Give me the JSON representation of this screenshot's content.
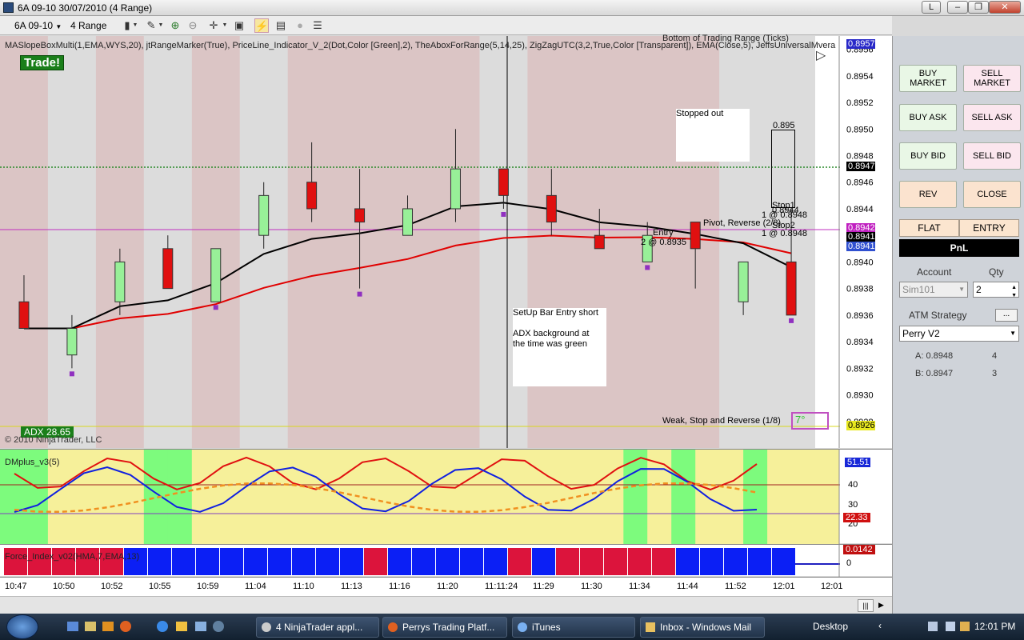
{
  "window": {
    "title": "6A 09-10  30/07/2010 (4 Range)",
    "btn_l": "L",
    "btn_min": "‒",
    "btn_max": "❐",
    "btn_close": "✕"
  },
  "toolbar": {
    "instrument": "6A 09-10",
    "period": "4 Range"
  },
  "chart": {
    "indicators_line": "MASlopeBoxMulti(1,EMA,WYS,20), jtRangeMarker(True), PriceLine_Indicator_V_2(Dot,Color [Green],2), TheAboxForRange(5,14,25), ZigZagUTC(3,2,True,Color [Transparent]), EMA(Close,5), JeffsUniversalM",
    "indicators_tail": "vera",
    "hidden_label": "Bottom of Trading Range (Ticks)",
    "trade_badge": "Trade!",
    "adx_badge": "ADX 28.65",
    "copyright": "© 2010 NinjaTrader, LLC",
    "y_labels": [
      "0.8956",
      "0.8954",
      "0.8952",
      "0.8950",
      "0.8948",
      "0.8946",
      "0.8944",
      "0.8942",
      "0.8940",
      "0.8938",
      "0.8936",
      "0.8934",
      "0.8932",
      "0.8930",
      "0.8928"
    ],
    "tags": {
      "top": "0.8957",
      "price": "0.8947",
      "pink": "0.8942",
      "black": "0.8941",
      "blue": "0.8941",
      "bottom": "0.8926"
    },
    "annotations": {
      "stopped_out": "Stopped out",
      "setup_line1": "SetUp Bar Entry short",
      "setup_line2": "ADX background at",
      "setup_line3": "the time was green",
      "entry_line1": "Entry",
      "entry_line2": "2 @ 0.8935",
      "pivot": "Pivot, Reverse (2/8)",
      "stop1": "Stop1",
      "stop1_val": "1 @ 0.8948",
      "stop2": "Stop2",
      "stop2_val": "1 @ 0.8948",
      "target_895": "0.895",
      "target_8944": "0.8944",
      "weak": "Weak, Stop and Reverse (1/8)",
      "degrees": "7°"
    }
  },
  "dm_panel": {
    "title": "DMplus_v3(5)",
    "y_labels": [
      "40",
      "30",
      "20"
    ],
    "tag_blue": "51.51",
    "tag_red": "22.33"
  },
  "force_panel": {
    "title": "Force_Index_v02(HMA,7,EMA,13)",
    "tag": "0.0142",
    "zero": "0"
  },
  "x_axis": [
    "10:47",
    "10:50",
    "10:52",
    "10:55",
    "10:59",
    "11:04",
    "11:10",
    "11:13",
    "11:16",
    "11:20",
    "11:11:24",
    "11:29",
    "11:30",
    "11:34",
    "11:44",
    "11:52",
    "12:01",
    "12:01"
  ],
  "side": {
    "buy_market": "BUY MARKET",
    "sell_market": "SELL MARKET",
    "buy_ask": "BUY ASK",
    "sell_ask": "SELL ASK",
    "buy_bid": "BUY BID",
    "sell_bid": "SELL BID",
    "rev": "REV",
    "close": "CLOSE",
    "flat": "FLAT",
    "entry": "ENTRY",
    "pnl": "PnL",
    "account_label": "Account",
    "qty_label": "Qty",
    "account_value": "Sim101",
    "qty_value": "2",
    "atm_label": "ATM Strategy",
    "atm_btn": "...",
    "atm_value": "Perry V2",
    "a_label": "A: 0.8948",
    "a_count": "4",
    "b_label": "B: 0.8947",
    "b_count": "3"
  },
  "taskbar": {
    "items": [
      "4 NinjaTrader appl...",
      "Perrys Trading Platf...",
      "iTunes",
      "Inbox - Windows Mail"
    ],
    "desktop": "Desktop",
    "clock": "12:01 PM"
  },
  "chart_data": [
    {
      "type": "candlestick",
      "title": "6A 09-10  30/07/2010 (4 Range)",
      "x": [
        "10:47",
        "10:50",
        "10:52",
        "10:55",
        "10:59",
        "11:04",
        "11:10",
        "11:13",
        "11:16",
        "11:20",
        "11:11:24",
        "11:29",
        "11:30",
        "11:34",
        "11:44",
        "11:52",
        "12:01"
      ],
      "candles": [
        {
          "o": 0.8937,
          "c": 0.8935,
          "h": 0.8939,
          "l": 0.8935,
          "dir": "down"
        },
        {
          "o": 0.8933,
          "c": 0.8935,
          "h": 0.8936,
          "l": 0.8932,
          "dir": "up"
        },
        {
          "o": 0.8937,
          "c": 0.894,
          "h": 0.8941,
          "l": 0.8936,
          "dir": "up"
        },
        {
          "o": 0.8941,
          "c": 0.8938,
          "h": 0.8942,
          "l": 0.8938,
          "dir": "down"
        },
        {
          "o": 0.8937,
          "c": 0.8941,
          "h": 0.8941,
          "l": 0.8937,
          "dir": "up"
        },
        {
          "o": 0.8942,
          "c": 0.8945,
          "h": 0.8946,
          "l": 0.8941,
          "dir": "up"
        },
        {
          "o": 0.8946,
          "c": 0.8944,
          "h": 0.8949,
          "l": 0.8943,
          "dir": "down"
        },
        {
          "o": 0.8944,
          "c": 0.8943,
          "h": 0.8947,
          "l": 0.8938,
          "dir": "down"
        },
        {
          "o": 0.8942,
          "c": 0.8944,
          "h": 0.8945,
          "l": 0.8942,
          "dir": "up"
        },
        {
          "o": 0.8944,
          "c": 0.8947,
          "h": 0.895,
          "l": 0.8943,
          "dir": "up"
        },
        {
          "o": 0.8947,
          "c": 0.8945,
          "h": 0.8947,
          "l": 0.8944,
          "dir": "down"
        },
        {
          "o": 0.8945,
          "c": 0.8943,
          "h": 0.8947,
          "l": 0.8942,
          "dir": "down"
        },
        {
          "o": 0.8942,
          "c": 0.8941,
          "h": 0.8944,
          "l": 0.8941,
          "dir": "down"
        },
        {
          "o": 0.894,
          "c": 0.8942,
          "h": 0.8943,
          "l": 0.894,
          "dir": "up"
        },
        {
          "o": 0.8943,
          "c": 0.8941,
          "h": 0.8943,
          "l": 0.8938,
          "dir": "down"
        },
        {
          "o": 0.8937,
          "c": 0.894,
          "h": 0.894,
          "l": 0.8936,
          "dir": "up"
        },
        {
          "o": 0.894,
          "c": 0.8936,
          "h": 0.8944,
          "l": 0.8936,
          "dir": "down"
        }
      ],
      "ylim": [
        0.8926,
        0.8957
      ],
      "series": [
        {
          "name": "EMA(Close,5)",
          "color": "#000000"
        },
        {
          "name": "MASlopeBoxMulti",
          "color": "#e00000"
        }
      ]
    }
  ],
  "colors": {
    "bg_pink": "#dbc5c5",
    "bg_grey": "#dcdcdc",
    "bg_yellow": "#f6f09a",
    "bg_green": "#7dfb7d",
    "up_candle": "#98f098",
    "down_candle": "#e01010",
    "force_red": "#dc143c",
    "force_blue": "#0b1ff5",
    "trade_green": "#1a7f1a"
  }
}
